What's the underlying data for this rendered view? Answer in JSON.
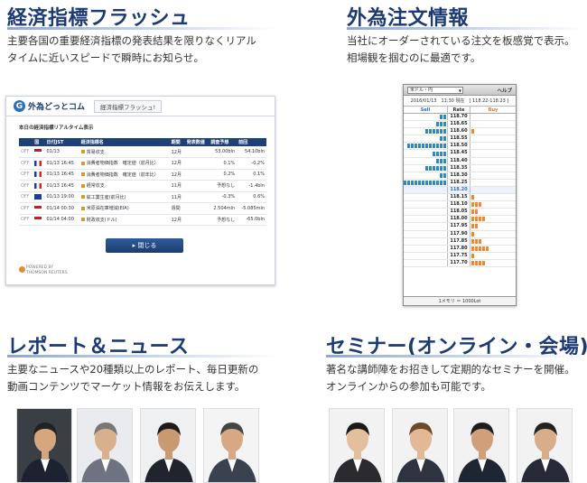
{
  "sections": {
    "flash": {
      "title": "経済指標フラッシュ",
      "desc_line1": "主要各国の重要経済指標の発表結果を限りなくリアル",
      "desc_line2": "タイムに近いスピードで瞬時にお知らせ。"
    },
    "order": {
      "title": "外為注文情報",
      "desc_line1": "当社にオーダーされている注文を板感覚で表示。",
      "desc_line2": "相場観を掴むのに最適です。"
    },
    "report": {
      "title": "レポート＆ニュース",
      "desc_line1": "主要なニュースや20種類以上のレポート、毎日更新の",
      "desc_line2": "動画コンテンツでマーケット情報をお伝えします。"
    },
    "seminar": {
      "title": "セミナー(オンライン・会場)",
      "desc_line1": "著名な講師陣をお招きして定期的なセミナーを開催。",
      "desc_line2": "オンラインからの参加も可能です。"
    }
  },
  "flash_panel": {
    "logo_text": "外為どっとコム",
    "header_title": "経済指標フラッシュ!",
    "subtitle": "本日の経済指標リアルタイム表示",
    "columns": [
      "",
      "国",
      "日付JST",
      "経済指標名",
      "期間",
      "発表数値",
      "調査予想",
      "前回"
    ],
    "rows": [
      {
        "status": "OFF",
        "flag": "us",
        "date": "01/13",
        "name": "貿易収支",
        "period": "12月",
        "actual": "",
        "forecast": "53.00bln",
        "previous": "54.10bln"
      },
      {
        "status": "OFF",
        "flag": "fr",
        "date": "01/13 16:45",
        "name": "消費者物価指数　確定値（前月比）",
        "period": "12月",
        "actual": "",
        "forecast": "0.1%",
        "previous": "-0.2%"
      },
      {
        "status": "OFF",
        "flag": "fr",
        "date": "01/13 16:45",
        "name": "消費者物価指数　確定値（前年比）",
        "period": "12月",
        "actual": "",
        "forecast": "0.2%",
        "previous": "0.1%"
      },
      {
        "status": "OFF",
        "flag": "fr",
        "date": "01/13 16:45",
        "name": "経常収支",
        "period": "11月",
        "actual": "",
        "forecast": "予想なし",
        "previous": "-1.4bln"
      },
      {
        "status": "OFF",
        "flag": "eu",
        "date": "01/13 19:00",
        "name": "鉱工業生産(前月比)",
        "period": "11月",
        "actual": "",
        "forecast": "-0.3%",
        "previous": "0.6%"
      },
      {
        "status": "OFF",
        "flag": "us",
        "date": "01/14 00:30",
        "name": "米原油在庫増減(EIA)",
        "period": "週間",
        "actual": "",
        "forecast": "2.504mln",
        "previous": "-5.085mln"
      },
      {
        "status": "OFF",
        "flag": "us",
        "date": "01/14 04:00",
        "name": "財政収支(ドル)",
        "period": "12月",
        "actual": "",
        "forecast": "予想なし",
        "previous": "-65.0bln"
      }
    ],
    "close_label": "▸ 閉じる",
    "reuters_line1": "POWERED BY",
    "reuters_line2": "THOMSON REUTERS"
  },
  "order_panel": {
    "pair": "米ドル・円",
    "help": "ヘルプ",
    "info": "2016/01/13　11:30 現在　[ 118.22-118.23 ]",
    "sell_label": "Sell",
    "rate_label": "Rate",
    "buy_label": "Buy",
    "rows": [
      {
        "rate": "118.70",
        "sell": 2,
        "buy": 0
      },
      {
        "rate": "118.65",
        "sell": 3,
        "buy": 0
      },
      {
        "rate": "118.60",
        "sell": 6,
        "buy": 1
      },
      {
        "rate": "118.55",
        "sell": 2,
        "buy": 0
      },
      {
        "rate": "118.50",
        "sell": 11,
        "buy": 0
      },
      {
        "rate": "118.45",
        "sell": 4,
        "buy": 0
      },
      {
        "rate": "118.40",
        "sell": 3,
        "buy": 0
      },
      {
        "rate": "118.35",
        "sell": 6,
        "buy": 0
      },
      {
        "rate": "118.30",
        "sell": 2,
        "buy": 0
      },
      {
        "rate": "118.25",
        "sell": 12,
        "buy": 0
      },
      {
        "rate": "118.20",
        "sell": 0,
        "buy": 0
      },
      {
        "rate": "118.15",
        "sell": 0,
        "buy": 1
      },
      {
        "rate": "118.10",
        "sell": 0,
        "buy": 3
      },
      {
        "rate": "118.05",
        "sell": 0,
        "buy": 2
      },
      {
        "rate": "118.00",
        "sell": 0,
        "buy": 4
      },
      {
        "rate": "117.95",
        "sell": 0,
        "buy": 2
      },
      {
        "rate": "117.90",
        "sell": 0,
        "buy": 1
      },
      {
        "rate": "117.85",
        "sell": 0,
        "buy": 3
      },
      {
        "rate": "117.80",
        "sell": 0,
        "buy": 5
      },
      {
        "rate": "117.75",
        "sell": 0,
        "buy": 1
      },
      {
        "rate": "117.70",
        "sell": 0,
        "buy": 4
      }
    ],
    "current_rate": "118.20",
    "footer": "1メモリ ＝ 1000Lot"
  },
  "colors": {
    "title": "#1c3a73",
    "sell": "#2f86c8",
    "buy": "#e88a2e",
    "flash_header": "#1f3f78"
  },
  "photos": {
    "report": [
      "speaker-photo-1",
      "speaker-photo-2",
      "speaker-photo-3",
      "speaker-photo-4"
    ],
    "seminar": [
      "lecturer-photo-1",
      "lecturer-photo-2",
      "lecturer-photo-3",
      "lecturer-photo-4"
    ]
  }
}
